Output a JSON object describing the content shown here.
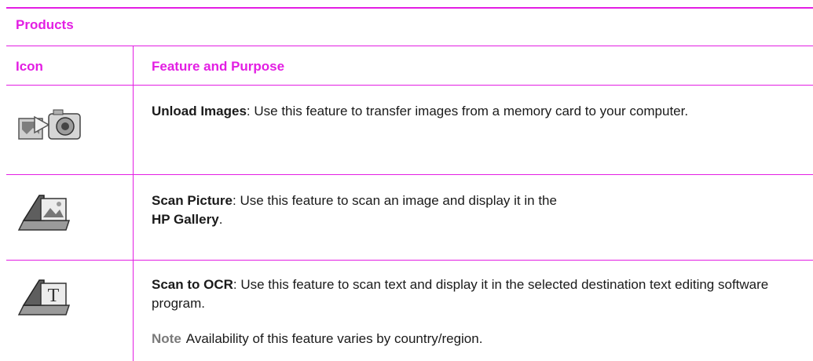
{
  "table": {
    "caption": "Products",
    "columns": {
      "icon": "Icon",
      "feature": "Feature and Purpose"
    },
    "rows": [
      {
        "icon_name": "unload-images-icon",
        "title": "Unload Images",
        "text": ": Use this feature to transfer images from a memory card to your computer."
      },
      {
        "icon_name": "scan-picture-icon",
        "title": "Scan Picture",
        "text_before": ": Use this feature to scan an image and display it in the",
        "link_text": "HP Gallery",
        "text_after": "."
      },
      {
        "icon_name": "scan-to-ocr-icon",
        "title": "Scan to OCR",
        "text": ": Use this feature to scan text and display it in the selected destination text editing software program.",
        "note_label": "Note",
        "note_text": "Availability of this feature varies by country/region."
      }
    ]
  },
  "colors": {
    "accent": "#e31ee3",
    "text": "#1a1a1a",
    "note_label": "#7a7a7a"
  }
}
